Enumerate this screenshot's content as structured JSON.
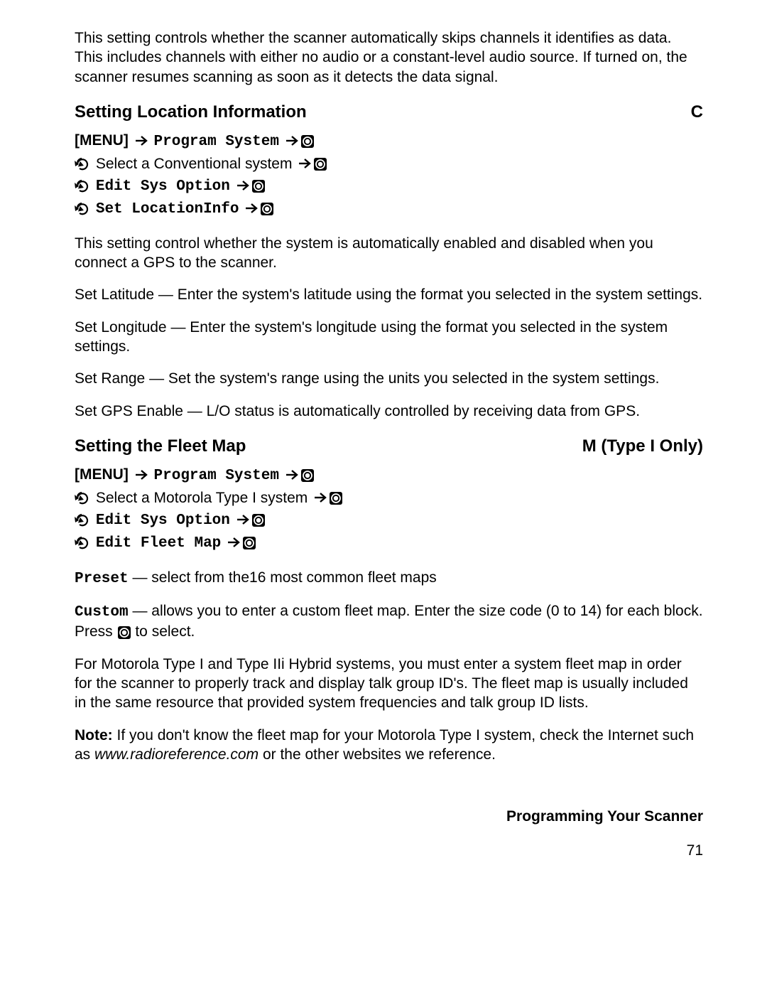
{
  "intro_para": "This setting controls whether the scanner automatically skips channels it identifies as data. This includes channels with either no audio or a constant-level audio source. If turned on, the scanner resumes scanning as soon as it detects the data signal.",
  "section1": {
    "title": "Setting Location Information",
    "tag": "C",
    "nav": {
      "menu_key": "[MENU]",
      "program_system": "Program System",
      "select_line": "Select a Conventional system",
      "edit_sys_option": "Edit Sys Option",
      "set_location": "Set LocationInfo"
    },
    "para1": "This setting control whether the system is automatically enabled and disabled when you connect a GPS to the scanner.",
    "para2": "Set Latitude — Enter the system's latitude using the format you selected in the system settings.",
    "para3": "Set Longitude — Enter the system's longitude using the format you selected in the system settings.",
    "para4": "Set Range — Set the system's range using the units you selected in the system settings.",
    "para5": "Set GPS Enable — L/O status is automatically controlled by receiving data from GPS."
  },
  "section2": {
    "title": "Setting the Fleet Map",
    "tag": "M (Type I Only)",
    "nav": {
      "menu_key": "[MENU]",
      "program_system": "Program System",
      "select_line": "Select a Motorola Type I system",
      "edit_sys_option": "Edit Sys Option",
      "edit_fleet_map": "Edit Fleet Map"
    },
    "preset_label": "Preset",
    "preset_text": " — select from the16 most common fleet maps",
    "custom_label": "Custom",
    "custom_text_a": " — allows you to enter a custom fleet map. Enter the size code (0 to 14) for each block. Press ",
    "custom_text_b": " to select.",
    "para3": "For Motorola Type I and Type IIi Hybrid systems, you must enter a system fleet map in order for the scanner to properly track and display talk group ID's. The fleet map is usually included in the same resource that provided system frequencies and talk group ID lists.",
    "note_label": "Note:",
    "note_text_a": " If you don't know the fleet map for your Motorola Type I system, check the Internet such as ",
    "note_url": "www.radioreference.com",
    "note_text_b": " or the other websites we reference."
  },
  "footer": "Programming Your Scanner",
  "page": "71"
}
